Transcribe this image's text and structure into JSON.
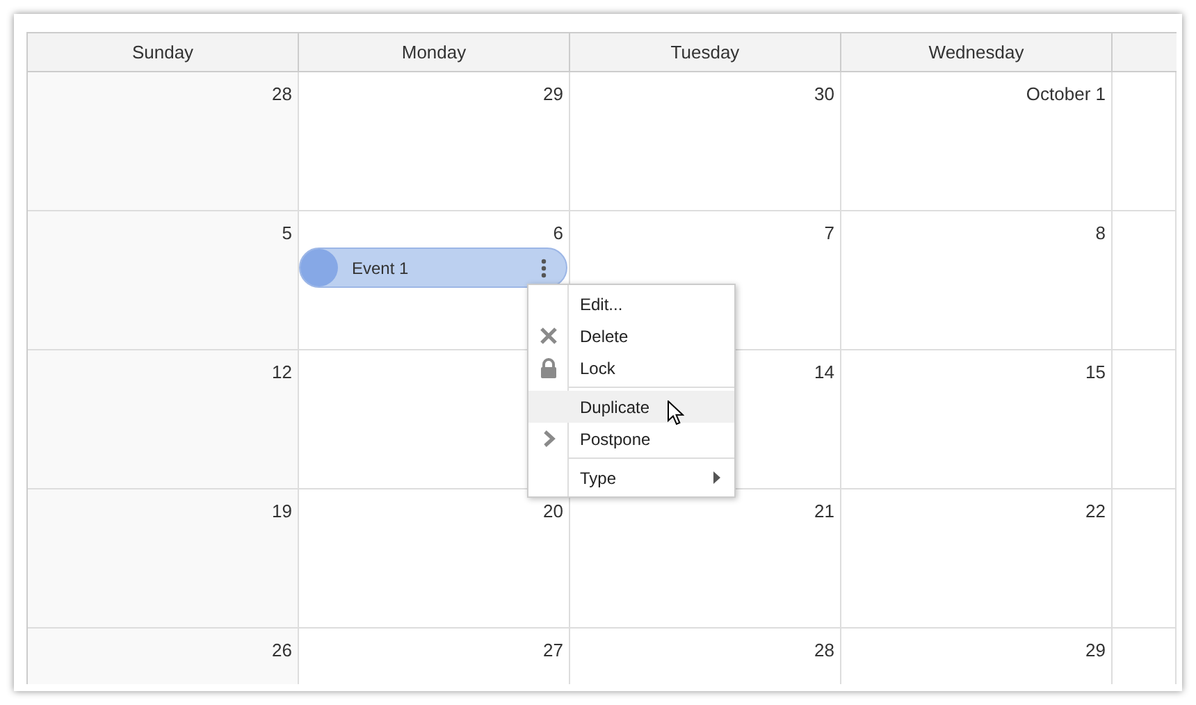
{
  "calendar": {
    "columns": [
      "Sunday",
      "Monday",
      "Tuesday",
      "Wednesday"
    ],
    "weeks": [
      {
        "cells": [
          {
            "day": "28"
          },
          {
            "day": "29"
          },
          {
            "day": "30"
          },
          {
            "day": "October 1"
          }
        ]
      },
      {
        "cells": [
          {
            "day": "5"
          },
          {
            "day": "6",
            "events": [
              {
                "text": "Event 1"
              }
            ]
          },
          {
            "day": "7"
          },
          {
            "day": "8"
          }
        ]
      },
      {
        "cells": [
          {
            "day": "12"
          },
          {},
          {
            "day": "14"
          },
          {
            "day": "15"
          }
        ]
      },
      {
        "cells": [
          {
            "day": "19"
          },
          {
            "day": "20"
          },
          {
            "day": "21"
          },
          {
            "day": "22"
          }
        ]
      },
      {
        "cells": [
          {
            "day": "26"
          },
          {
            "day": "27"
          },
          {
            "day": "28"
          },
          {
            "day": "29"
          }
        ]
      }
    ]
  },
  "context_menu": {
    "items": [
      {
        "kind": "item",
        "label": "Edit...",
        "highlighted": false,
        "has_submenu": false
      },
      {
        "kind": "item",
        "label": "Delete",
        "highlighted": false,
        "has_submenu": false
      },
      {
        "kind": "item",
        "label": "Lock",
        "highlighted": false,
        "has_submenu": false
      },
      {
        "kind": "separator"
      },
      {
        "kind": "item",
        "label": "Duplicate",
        "highlighted": true,
        "has_submenu": false
      },
      {
        "kind": "item",
        "label": "Postpone",
        "highlighted": false,
        "has_submenu": false
      },
      {
        "kind": "separator"
      },
      {
        "kind": "item",
        "label": "Type",
        "highlighted": false,
        "has_submenu": true
      }
    ]
  }
}
